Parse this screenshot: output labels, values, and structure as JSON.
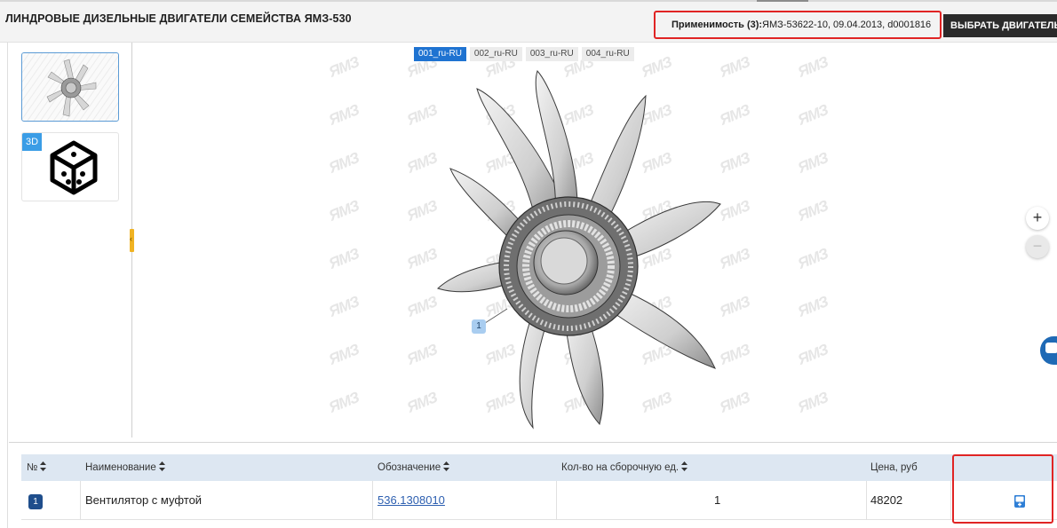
{
  "header": {
    "title": "ЛИНДРОВЫЕ ДИЗЕЛЬНЫЕ ДВИГАТЕЛИ СЕМЕЙСТВА ЯМЗ-530",
    "applicability_label": "Применимость (3):",
    "applicability_value": "ЯМЗ-53622-10, 09.04.2013, d0001816",
    "select_engine_label": "ВЫБРАТЬ ДВИГАТЕЛЬ"
  },
  "thumbnails": [
    {
      "label": "fan-thumbnail",
      "selected": true
    },
    {
      "label": "3D",
      "selected": false
    }
  ],
  "viewer": {
    "sheet_tabs": [
      "001_ru-RU",
      "002_ru-RU",
      "003_ru-RU",
      "004_ru-RU"
    ],
    "active_sheet": "001_ru-RU",
    "callout": "1",
    "watermark": "ЯМЗ",
    "zoom_in": "+",
    "zoom_out": "−"
  },
  "table": {
    "columns": [
      "№",
      "Наименование",
      "Обозначение",
      "Кол-во на сборочную ед.",
      "Цена, руб"
    ],
    "rows": [
      {
        "num": "1",
        "name": "Вентилятор с муфтой",
        "designation": "536.1308010",
        "qty": "1",
        "price": "48202"
      }
    ]
  },
  "icons": {
    "sort": "sort-icon",
    "cart": "cart-icon",
    "cube3d": "cube-3d-icon",
    "chat": "chat-icon"
  },
  "colors": {
    "accent_blue": "#1f73d1",
    "highlight_red": "#e02424",
    "header_dark": "#2b2b2b",
    "table_header_bg": "#dde7f2",
    "handle_yellow": "#f0b323"
  }
}
